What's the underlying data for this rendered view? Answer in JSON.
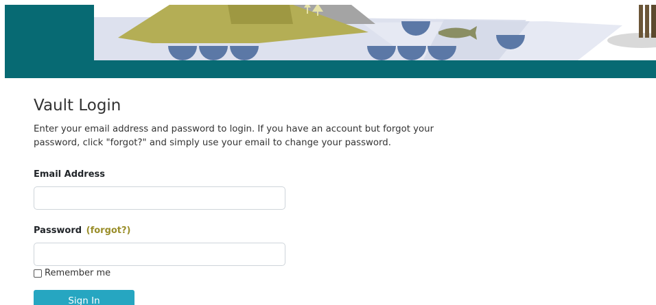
{
  "header": {
    "banner_icon": "landscape-illustration",
    "colors": {
      "teal": "#076a73",
      "water": "#dde1ee",
      "hill": "#b4ae55",
      "hill_dark": "#a59f45",
      "rock": "#a4a4a4",
      "arch": "#5b78a6",
      "fish": "#8a8e63",
      "post": "#6b5638"
    }
  },
  "login": {
    "title": "Vault Login",
    "intro": "Enter your email address and password to login. If you have an account but forgot your password, click \"forgot?\" and simply use your email to change your password.",
    "email_label": "Email Address",
    "email_value": "",
    "password_label": "Password",
    "forgot_link": "(forgot?)",
    "password_value": "",
    "remember_label": "Remember me",
    "signin_label": "Sign In"
  },
  "colors": {
    "accent": "#26a6c1",
    "forgot_link": "#9a8e2a",
    "highlight": "#fffd6e"
  }
}
